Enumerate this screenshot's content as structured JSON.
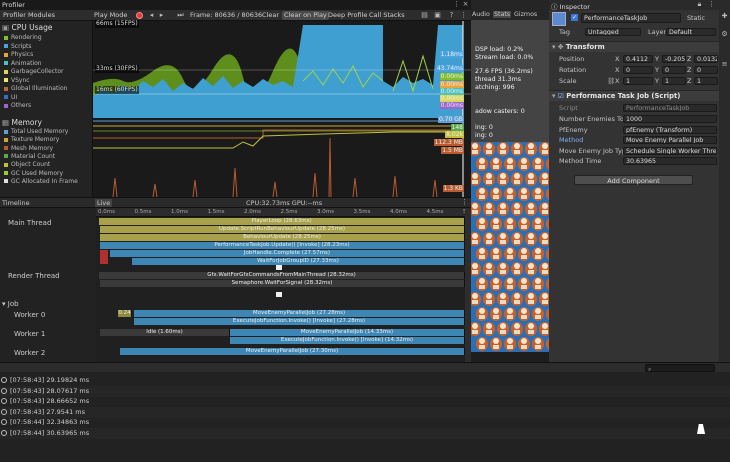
{
  "profiler": {
    "title": "Profiler",
    "modules_dropdown": "Profiler Modules",
    "play_mode": "Play Mode",
    "frame": "Frame: 80636 / 80636",
    "clear": "Clear",
    "clear_on_play": "Clear on Play",
    "deep_profile": "Deep Profile",
    "call_stacks": "Call Stacks",
    "cpu_usage": "CPU Usage",
    "cpu_items": [
      {
        "label": "Rendering",
        "color": "#7fbf2f"
      },
      {
        "label": "Scripts",
        "color": "#4aa3df"
      },
      {
        "label": "Physics",
        "color": "#e8a33a"
      },
      {
        "label": "Animation",
        "color": "#4fc0c0"
      },
      {
        "label": "GarbageCollector",
        "color": "#d8d85a"
      },
      {
        "label": "VSync",
        "color": "#e8e870"
      },
      {
        "label": "Global Illumination",
        "color": "#b36a3a"
      },
      {
        "label": "UI",
        "color": "#3b6fb5"
      },
      {
        "label": "Others",
        "color": "#9a66cc"
      }
    ],
    "memory": "Memory",
    "mem_items": [
      {
        "label": "Total Used Memory",
        "color": "#5fa0d8"
      },
      {
        "label": "Texture Memory",
        "color": "#c9a93a"
      },
      {
        "label": "Mesh Memory",
        "color": "#b85c30"
      },
      {
        "label": "Material Count",
        "color": "#5ca84a"
      },
      {
        "label": "Object Count",
        "color": "#c0c040"
      },
      {
        "label": "GC Used Memory",
        "color": "#9acd32"
      },
      {
        "label": "GC Allocated In Frame",
        "color": "#e0e0e0"
      }
    ],
    "cpu_grid": [
      "66ms (15FPS)",
      "33ms (30FPS)",
      "16ms (60FPS)"
    ],
    "cpu_right": [
      "1.18ms",
      "43.74ms",
      "0.00ms",
      "0.00ms",
      "0.00ms",
      "0.00ms",
      "0.00ms"
    ],
    "mem_right": [
      "0.70 GB",
      "148",
      "8.02k",
      "112.3 MB",
      "1.5 MB",
      "1.3 KB"
    ],
    "timeline": "Timeline",
    "live": "Live",
    "cpu_gpu": "CPU:32.73ms   GPU:--ms",
    "ruler": [
      "0.0ms",
      "0.5ms",
      "1.0ms",
      "1.5ms",
      "2.0ms",
      "2.5ms",
      "3.0ms",
      "3.5ms",
      "4.0ms",
      "4.5ms",
      "5.0ms"
    ],
    "threads": {
      "main": "Main Thread",
      "render": "Render Thread",
      "job": "Job",
      "w0": "Worker 0",
      "w1": "Worker 1",
      "w2": "Worker 2"
    },
    "main_blocks": [
      "PlayerLoop (28.63ms)",
      "Update.ScriptRunBehaviourUpdate (28.25ms)",
      "BehaviourUpdate (28.25ms)",
      "PerformanceTaskJob.Update() [Invoke] (28.23ms)",
      "JobHandle.Complete (27.57ms)",
      "WaitForJobGroupID (27.33ms)"
    ],
    "render_blocks": [
      "Gfx.WaitForGfxCommandsFromMainThread (28.32ms)",
      "Semaphore.WaitForSignal (28.32ms)"
    ],
    "w0_blocks": [
      "MoveEnemyParallelJob (27.28ms)",
      "ExecuteJobFunction.Invoke() [Invoke] (27.28ms)"
    ],
    "w1_blocks": [
      "Idle (1.60ms)",
      "MoveEnemyParallelJob (14.33ms)",
      "ExecuteJobFunction.Invoke() [Invoke] (14.32ms)"
    ],
    "w2_blocks": [
      "MoveEnemyParallelJob (27.30ms)"
    ],
    "w0_small": "0.24"
  },
  "game": {
    "tabs": [
      "Audio",
      "Stats",
      "Gizmos"
    ],
    "stats": [
      "DSP load: 0.2%",
      "Stream load: 0.0%",
      "27.6 FPS (36.2ms)",
      "thread 31.3ms",
      "atching: 996",
      "adow casters: 0",
      "ing: 0",
      "ing: 0"
    ]
  },
  "inspector": {
    "tab": "Inspector",
    "object_name": "PerformanceTaskJob",
    "static": "Static",
    "tag_label": "Tag",
    "tag_value": "Untagged",
    "layer_label": "Layer",
    "layer_value": "Default",
    "transform": "Transform",
    "position": "Position",
    "rotation": "Rotation",
    "scale": "Scale",
    "pos": {
      "x": "0.4112",
      "y": "-0.205",
      "z": "0.0132"
    },
    "rot": {
      "x": "0",
      "y": "0",
      "z": "0"
    },
    "scl": {
      "x": "1",
      "y": "1",
      "z": "1"
    },
    "script_section": "Performance Task Job (Script)",
    "script_label": "Script",
    "script_value": "PerformanceTaskJob",
    "fields": [
      {
        "label": "Number Enemies To C",
        "value": "1000"
      },
      {
        "label": "PfEnemy",
        "value": "pfEnemy (Transform)"
      },
      {
        "label": "Method",
        "value": "Move Enemy Parallel Job"
      },
      {
        "label": "Move Enemy Job Typ",
        "value": "Schedule Single Worker Thre"
      },
      {
        "label": "Method Time",
        "value": "30.63965"
      }
    ],
    "add_component": "Add Component"
  },
  "console": {
    "logs": [
      "[07:58:43] 29.19824 ms",
      "[07:58:43] 28.07617 ms",
      "[07:58:43] 28.66652 ms",
      "[07:58:43] 27.9541 ms",
      "[07:58:44] 32.34863 ms",
      "[07:58:44] 30.63965 ms"
    ]
  }
}
